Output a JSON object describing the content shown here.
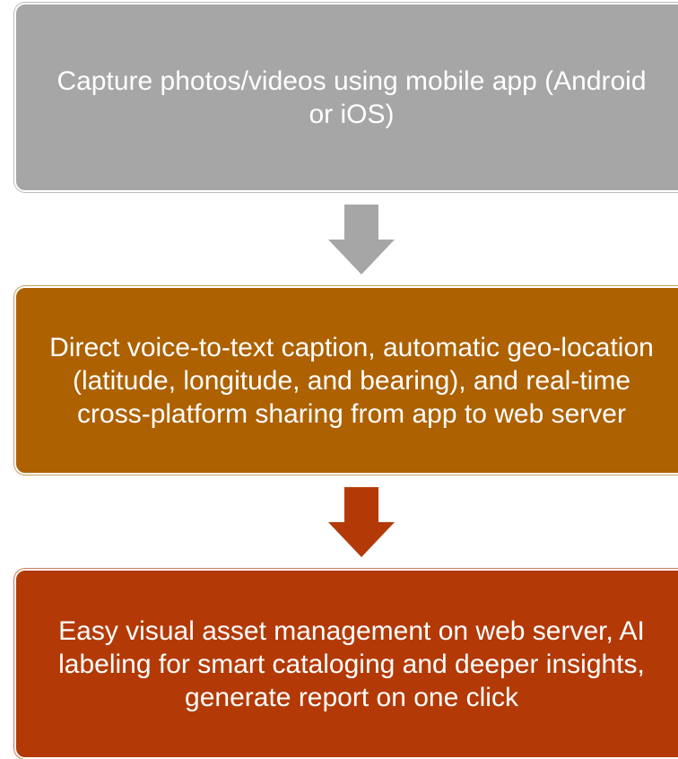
{
  "colors": {
    "step1_fill": "#a6a6a6",
    "step2_fill": "#ad6100",
    "step3_fill": "#b33a07",
    "arrow1_fill": "#a6a6a6",
    "arrow2_fill": "#b33a07",
    "text": "#ffffff"
  },
  "steps": [
    {
      "text": "Capture photos/videos using mobile app (Android or iOS)"
    },
    {
      "text": "Direct voice-to-text caption, automatic geo-location (latitude, longitude, and bearing), and real-time cross-platform sharing from app to web server"
    },
    {
      "text": "Easy visual asset management on web server, AI labeling for smart cataloging and deeper insights, generate report on one click"
    }
  ],
  "arrows": [
    {
      "icon": "arrow-down-icon"
    },
    {
      "icon": "arrow-down-icon"
    }
  ]
}
